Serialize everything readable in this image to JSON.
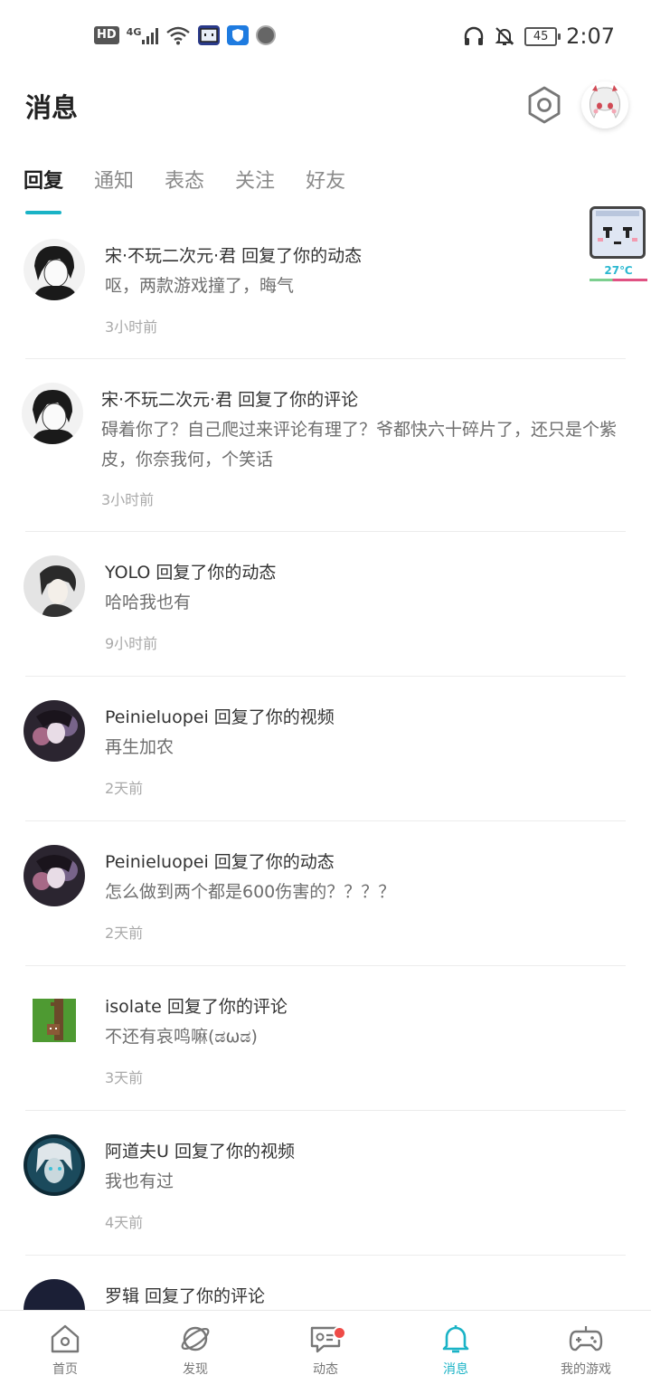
{
  "status_bar": {
    "hd": "HD",
    "network": "4G",
    "battery": "45",
    "time": "2:07"
  },
  "header": {
    "title": "消息"
  },
  "tabs": [
    {
      "label": "回复",
      "active": true
    },
    {
      "label": "通知"
    },
    {
      "label": "表态"
    },
    {
      "label": "关注"
    },
    {
      "label": "好友"
    }
  ],
  "pet_widget": {
    "temperature": "27℃"
  },
  "messages": [
    {
      "head": "宋·不玩二次元·君 回复了你的动态",
      "body": "呕，两款游戏撞了，晦气",
      "time": "3小时前"
    },
    {
      "head": "宋·不玩二次元·君 回复了你的评论",
      "body": "碍着你了？自己爬过来评论有理了？爷都快六十碎片了，还只是个紫皮，你奈我何，个笑话",
      "time": "3小时前"
    },
    {
      "head": "YOLO 回复了你的动态",
      "body": "哈哈我也有",
      "time": "9小时前"
    },
    {
      "head": "Peinieluopei 回复了你的视频",
      "body": "再生加农",
      "time": "2天前"
    },
    {
      "head": "Peinieluopei 回复了你的动态",
      "body": "怎么做到两个都是600伤害的？？？？",
      "time": "2天前"
    },
    {
      "head": "isolate 回复了你的评论",
      "body": "不还有哀鸣嘛(ಡωಡ)",
      "time": "3天前"
    },
    {
      "head": "阿道夫U 回复了你的视频",
      "body": "我也有过",
      "time": "4天前"
    },
    {
      "head": "罗辑 回复了你的评论",
      "body": "",
      "time": ""
    }
  ],
  "bottom_nav": [
    {
      "label": "首页",
      "icon": "home-icon"
    },
    {
      "label": "发现",
      "icon": "planet-icon"
    },
    {
      "label": "动态",
      "icon": "chat-icon",
      "badge": true
    },
    {
      "label": "消息",
      "icon": "bell-icon",
      "active": true
    },
    {
      "label": "我的游戏",
      "icon": "gamepad-icon"
    }
  ],
  "colors": {
    "accent": "#1ab3c6",
    "badge": "#ef4b47"
  }
}
